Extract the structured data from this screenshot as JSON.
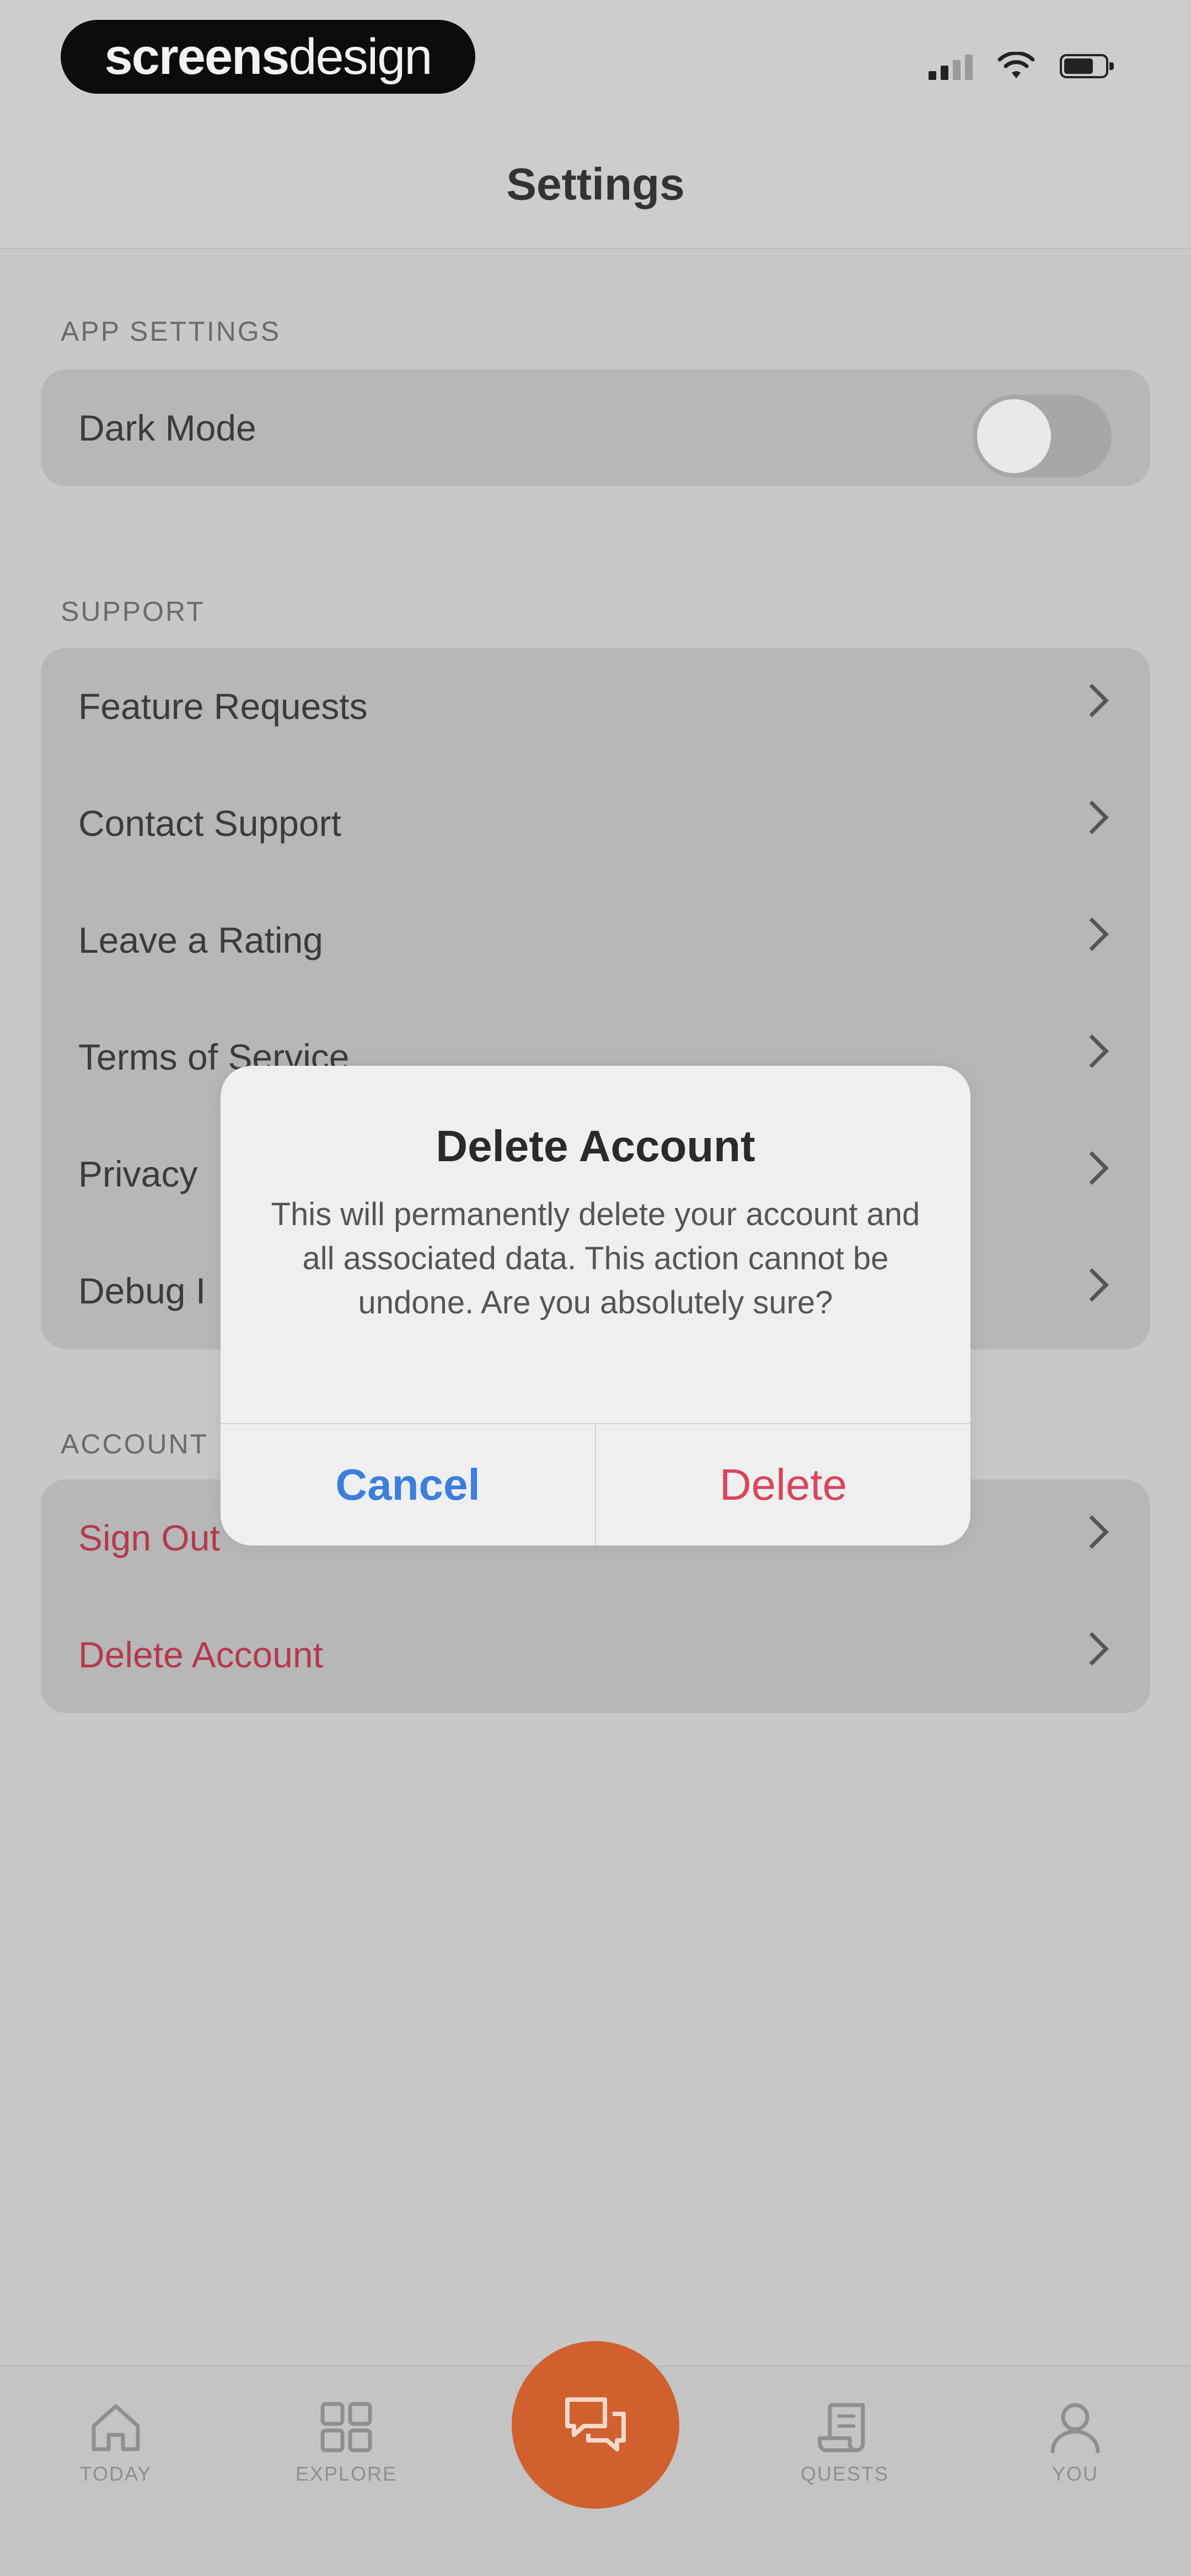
{
  "status_bar": {
    "brand_bold": "screens",
    "brand_light": "design"
  },
  "nav": {
    "title": "Settings"
  },
  "sections": {
    "app_settings": {
      "header": "APP SETTINGS",
      "dark_mode_label": "Dark Mode",
      "dark_mode_on": false
    },
    "support": {
      "header": "SUPPORT",
      "items": [
        {
          "label": "Feature Requests"
        },
        {
          "label": "Contact Support"
        },
        {
          "label": "Leave a Rating"
        },
        {
          "label": "Terms of Service"
        },
        {
          "label": "Privacy"
        },
        {
          "label": "Debug I"
        }
      ]
    },
    "account": {
      "header": "ACCOUNT",
      "items": [
        {
          "label": "Sign Out"
        },
        {
          "label": "Delete Account"
        }
      ]
    }
  },
  "dialog": {
    "title": "Delete Account",
    "message": "This will permanently delete your account and all associated data. This action cannot be undone. Are you absolutely sure?",
    "cancel_label": "Cancel",
    "delete_label": "Delete"
  },
  "tabbar": {
    "home": "TODAY",
    "explore": "EXPLORE",
    "quests": "QUESTS",
    "you": "YOU",
    "fab_icon": "chat-icon"
  },
  "colors": {
    "accent": "#d0612f",
    "danger": "#d9455c",
    "link": "#3a7fdc"
  }
}
